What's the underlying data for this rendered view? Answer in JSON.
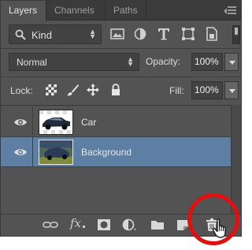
{
  "tabs": [
    {
      "label": "Layers",
      "active": true
    },
    {
      "label": "Channels",
      "active": false
    },
    {
      "label": "Paths",
      "active": false
    }
  ],
  "filter": {
    "kind_label": "Kind",
    "icons": [
      "pixel-layer-filter-icon",
      "adjustment-layer-filter-icon",
      "type-layer-filter-icon",
      "shape-layer-filter-icon",
      "smart-object-filter-icon"
    ]
  },
  "blend": {
    "mode": "Normal",
    "opacity_label": "Opacity:",
    "opacity_value": "100%"
  },
  "lock": {
    "label": "Lock:",
    "fill_label": "Fill:",
    "fill_value": "100%"
  },
  "layers": [
    {
      "name": "Car",
      "visible": true,
      "selected": false
    },
    {
      "name": "Background",
      "visible": true,
      "selected": true
    }
  ],
  "bottom": {
    "fx_label": "fx",
    "icons": [
      "link-layers-icon",
      "layer-style-icon",
      "add-mask-icon",
      "adjustment-layer-icon",
      "new-group-icon",
      "new-layer-icon",
      "delete-layer-icon"
    ]
  },
  "colors": {
    "panel": "#535353",
    "selection": "#5c7fa3",
    "highlight_ring": "#e01010"
  }
}
